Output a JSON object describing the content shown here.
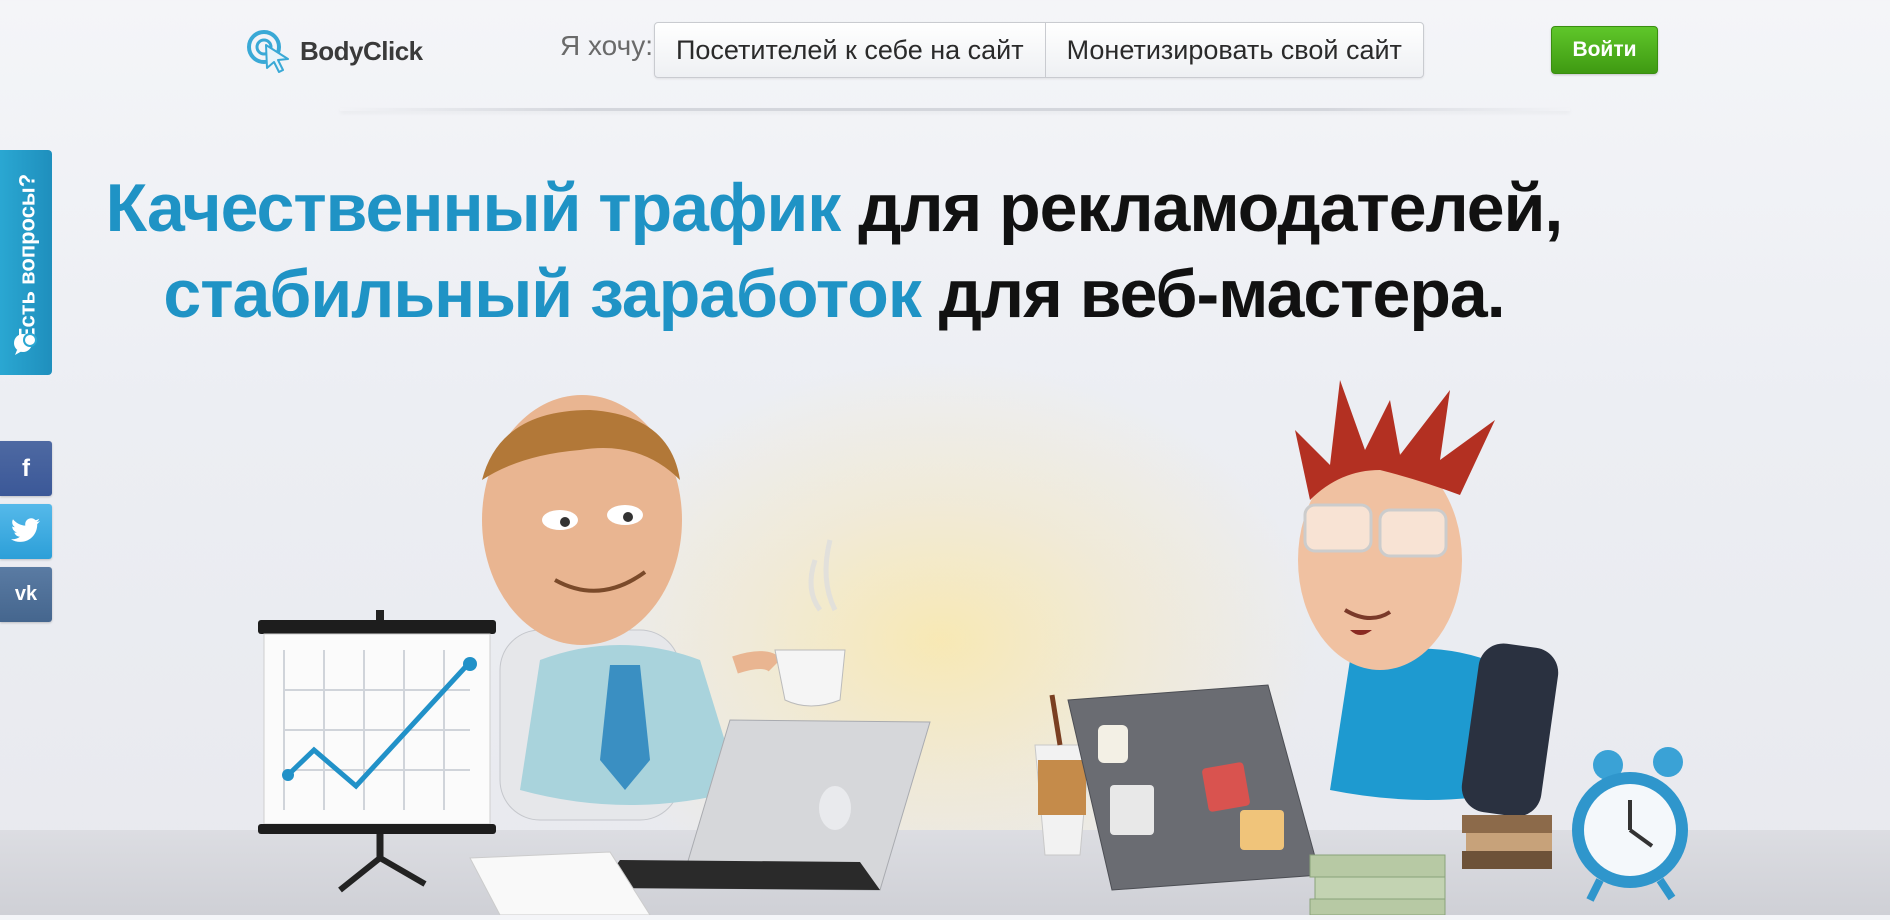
{
  "brand": {
    "name": "BodyClick"
  },
  "header": {
    "want_label": "Я хочу:",
    "options": [
      {
        "label": "Посетителей к себе на сайт"
      },
      {
        "label": "Монетизировать свой сайт"
      }
    ],
    "login_label": "Войти"
  },
  "sidebar": {
    "questions_label": "Есть вопросы?",
    "social": [
      {
        "label": "f",
        "icon": "facebook-icon"
      },
      {
        "label": "",
        "icon": "twitter-icon"
      },
      {
        "label": "vk",
        "icon": "vk-icon"
      }
    ]
  },
  "headline": {
    "line1_blue": "Качественный трафик",
    "line1_dark": " для рекламодателей,",
    "line2_blue": "стабильный заработок",
    "line2_dark": " для веб-мастера."
  },
  "colors": {
    "accent": "#1f93c5",
    "login_green": "#4fb41c",
    "facebook": "#3b5898",
    "twitter": "#2c9fd8",
    "vk": "#45668e"
  }
}
